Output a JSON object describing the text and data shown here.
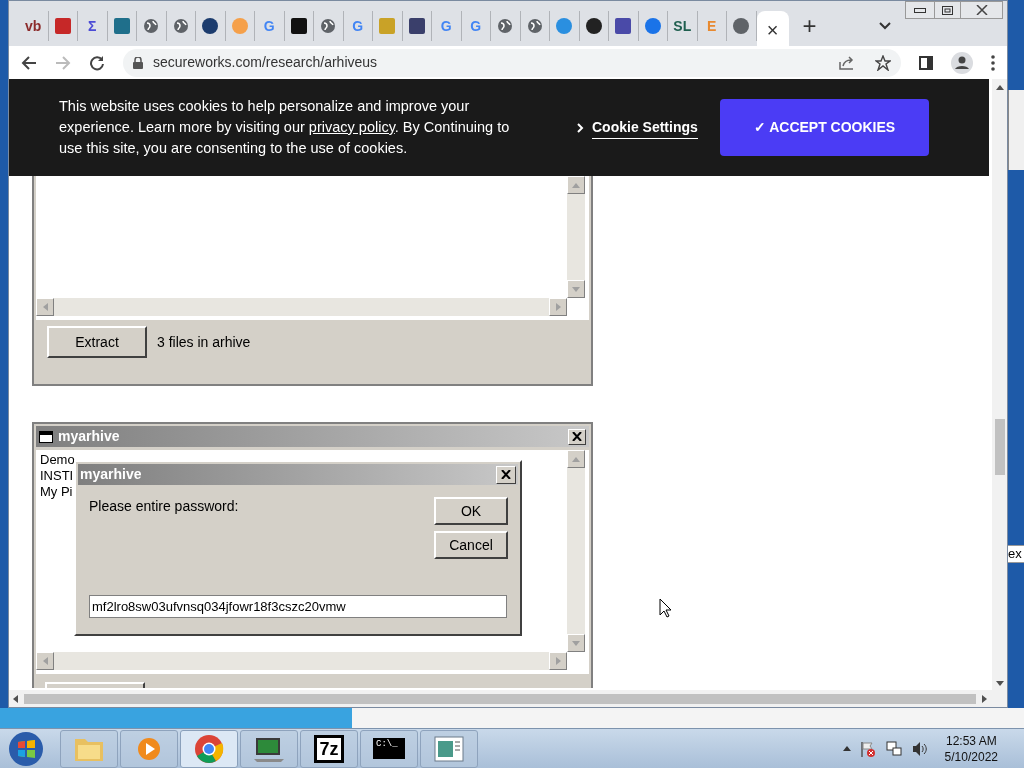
{
  "browser": {
    "tabs": [
      {
        "kind": "letter",
        "text": "vb",
        "color": "#8b2b2b"
      },
      {
        "kind": "tile",
        "color": "#c62828"
      },
      {
        "kind": "letter",
        "text": "Σ",
        "color": "#4b4bd6"
      },
      {
        "kind": "tile",
        "color": "#1f6f8b"
      },
      {
        "kind": "globe"
      },
      {
        "kind": "globe"
      },
      {
        "kind": "circle",
        "color": "#1c3c6e"
      },
      {
        "kind": "circle",
        "color": "#f5a04a"
      },
      {
        "kind": "letter",
        "text": "G",
        "color": "#4285f4"
      },
      {
        "kind": "tile",
        "color": "#111111"
      },
      {
        "kind": "globe"
      },
      {
        "kind": "letter",
        "text": "G",
        "color": "#4285f4"
      },
      {
        "kind": "tile",
        "color": "#c9a227"
      },
      {
        "kind": "tile",
        "color": "#3a3f6b"
      },
      {
        "kind": "letter",
        "text": "G",
        "color": "#4285f4"
      },
      {
        "kind": "letter",
        "text": "G",
        "color": "#4285f4"
      },
      {
        "kind": "globe"
      },
      {
        "kind": "globe"
      },
      {
        "kind": "circle",
        "color": "#2a8fe0"
      },
      {
        "kind": "circle",
        "color": "#222222"
      },
      {
        "kind": "tile",
        "color": "#4a4aa8"
      },
      {
        "kind": "circle",
        "color": "#1a73e8"
      },
      {
        "kind": "letter",
        "text": "SL",
        "color": "#1f5f4f"
      },
      {
        "kind": "letter",
        "text": "E",
        "color": "#e8892f"
      },
      {
        "kind": "circle",
        "color": "#5f6368"
      }
    ],
    "active_tab_close": "×",
    "new_tab": "+",
    "url": "secureworks.com/research/arhiveus"
  },
  "cookie_banner": {
    "text_before": "This website uses cookies to help personalize and improve your experience. Learn more by visiting our ",
    "link": "privacy policy",
    "text_after": ". By Continuing to use this site, you are consenting to the use of cookies.",
    "settings_link": "Cookie Settings",
    "accept_button": "✓ ACCEPT COOKIES"
  },
  "archive_panel": {
    "extract_button": "Extract",
    "status": "3 files in arhive"
  },
  "archive_window": {
    "title": "myarhive",
    "files": [
      "Demo",
      "INSTI",
      "My Pi"
    ]
  },
  "password_dialog": {
    "title": "myarhive",
    "prompt": "Please entire password:",
    "ok_button": "OK",
    "cancel_button": "Cancel",
    "value": "mf2lro8sw03ufvnsq034jfowr18f3cszc20vmw"
  },
  "background_window": {
    "text": "ex"
  },
  "taskbar": {
    "apps": [
      {
        "kind": "folder",
        "selected": false
      },
      {
        "kind": "media",
        "selected": false
      },
      {
        "kind": "chrome",
        "selected": true
      },
      {
        "kind": "monitor",
        "selected": false
      },
      {
        "kind": "text",
        "text": "7z",
        "selected": false
      },
      {
        "kind": "console",
        "text": "C:\\_",
        "selected": false
      },
      {
        "kind": "window",
        "selected": false
      }
    ],
    "clock": {
      "time": "12:53 AM",
      "date": "5/10/2022"
    }
  }
}
